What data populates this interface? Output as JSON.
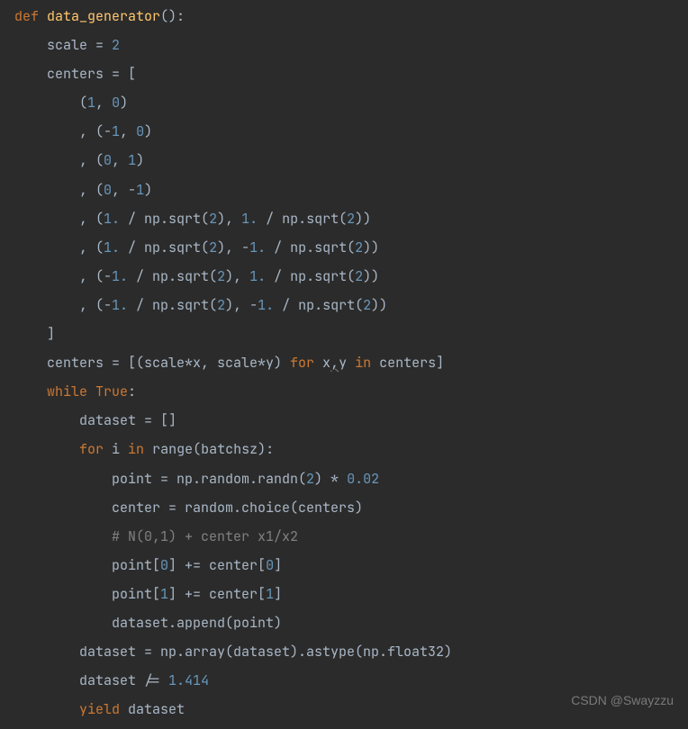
{
  "code": {
    "line1_def": "def",
    "line1_func": "data_generator",
    "line1_parens": "():",
    "line2_a": "scale = ",
    "line2_b": "2",
    "line3": "centers = [",
    "line4_a": "(",
    "line4_b": "1",
    "line4_c": ", ",
    "line4_d": "0",
    "line4_e": ")",
    "line5_a": ", (-",
    "line5_b": "1",
    "line5_c": ", ",
    "line5_d": "0",
    "line5_e": ")",
    "line6_a": ", (",
    "line6_b": "0",
    "line6_c": ", ",
    "line6_d": "1",
    "line6_e": ")",
    "line7_a": ", (",
    "line7_b": "0",
    "line7_c": ", -",
    "line7_d": "1",
    "line7_e": ")",
    "line8_a": ", (",
    "line8_b": "1.",
    "line8_c": " / np.sqrt(",
    "line8_d": "2",
    "line8_e": "), ",
    "line8_f": "1.",
    "line8_g": " / np.sqrt(",
    "line8_h": "2",
    "line8_i": "))",
    "line9_a": ", (",
    "line9_b": "1.",
    "line9_c": " / np.sqrt(",
    "line9_d": "2",
    "line9_e": "), -",
    "line9_f": "1.",
    "line9_g": " / np.sqrt(",
    "line9_h": "2",
    "line9_i": "))",
    "line10_a": ", (-",
    "line10_b": "1.",
    "line10_c": " / np.sqrt(",
    "line10_d": "2",
    "line10_e": "), ",
    "line10_f": "1.",
    "line10_g": " / np.sqrt(",
    "line10_h": "2",
    "line10_i": "))",
    "line11_a": ", (-",
    "line11_b": "1.",
    "line11_c": " / np.sqrt(",
    "line11_d": "2",
    "line11_e": "), -",
    "line11_f": "1.",
    "line11_g": " / np.sqrt(",
    "line11_h": "2",
    "line11_i": "))",
    "line12": "]",
    "line13_a": "centers = [(scale*x, scale*y) ",
    "line13_for": "for",
    "line13_b": " x",
    "line13_comma": ",",
    "line13_c": "y ",
    "line13_in": "in",
    "line13_d": " centers]",
    "line14_while": "while",
    "line14_true": " True",
    "line14_colon": ":",
    "line15": "dataset = []",
    "line16_for": "for",
    "line16_a": " i ",
    "line16_in": "in",
    "line16_b": " range(batchsz):",
    "line17_a": "point = np.random.randn(",
    "line17_b": "2",
    "line17_c": ") * ",
    "line17_d": "0.02",
    "line18": "center = random.choice(centers)",
    "line19": "# N(0,1) + center x1/x2",
    "line20_a": "point[",
    "line20_b": "0",
    "line20_c": "] += center[",
    "line20_d": "0",
    "line20_e": "]",
    "line21_a": "point[",
    "line21_b": "1",
    "line21_c": "] += center[",
    "line21_d": "1",
    "line21_e": "]",
    "line22": "dataset.append(point)",
    "line23": "dataset = np.array(dataset).astype(np.float32)",
    "line24_a": "dataset /= ",
    "line24_b": "1.414",
    "line25_yield": "yield",
    "line25_a": " dataset"
  },
  "watermark": "CSDN @Swayzzu"
}
